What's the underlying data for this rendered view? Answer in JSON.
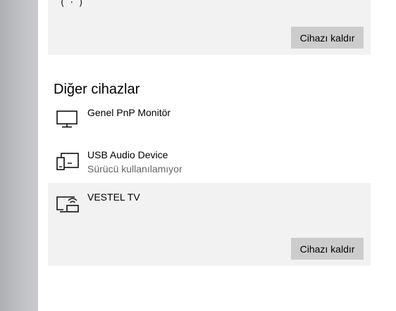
{
  "top_card": {
    "partial_icon_glyph": "(·)",
    "remove_label": "Cihazı kaldır"
  },
  "other_devices": {
    "title": "Diğer cihazlar",
    "items": [
      {
        "name": "Genel PnP Monitör",
        "status": "",
        "icon": "monitor-icon"
      },
      {
        "name": "USB Audio Device",
        "status": "Sürücü kullanılamıyor",
        "icon": "multi-device-icon"
      },
      {
        "name": "VESTEL TV",
        "status": "",
        "icon": "wireless-display-icon",
        "remove_label": "Cihazı kaldır",
        "selected": true
      }
    ]
  },
  "colors": {
    "card_bg": "#f2f2f2",
    "button_bg": "#cccccc",
    "status_text": "#666666"
  }
}
